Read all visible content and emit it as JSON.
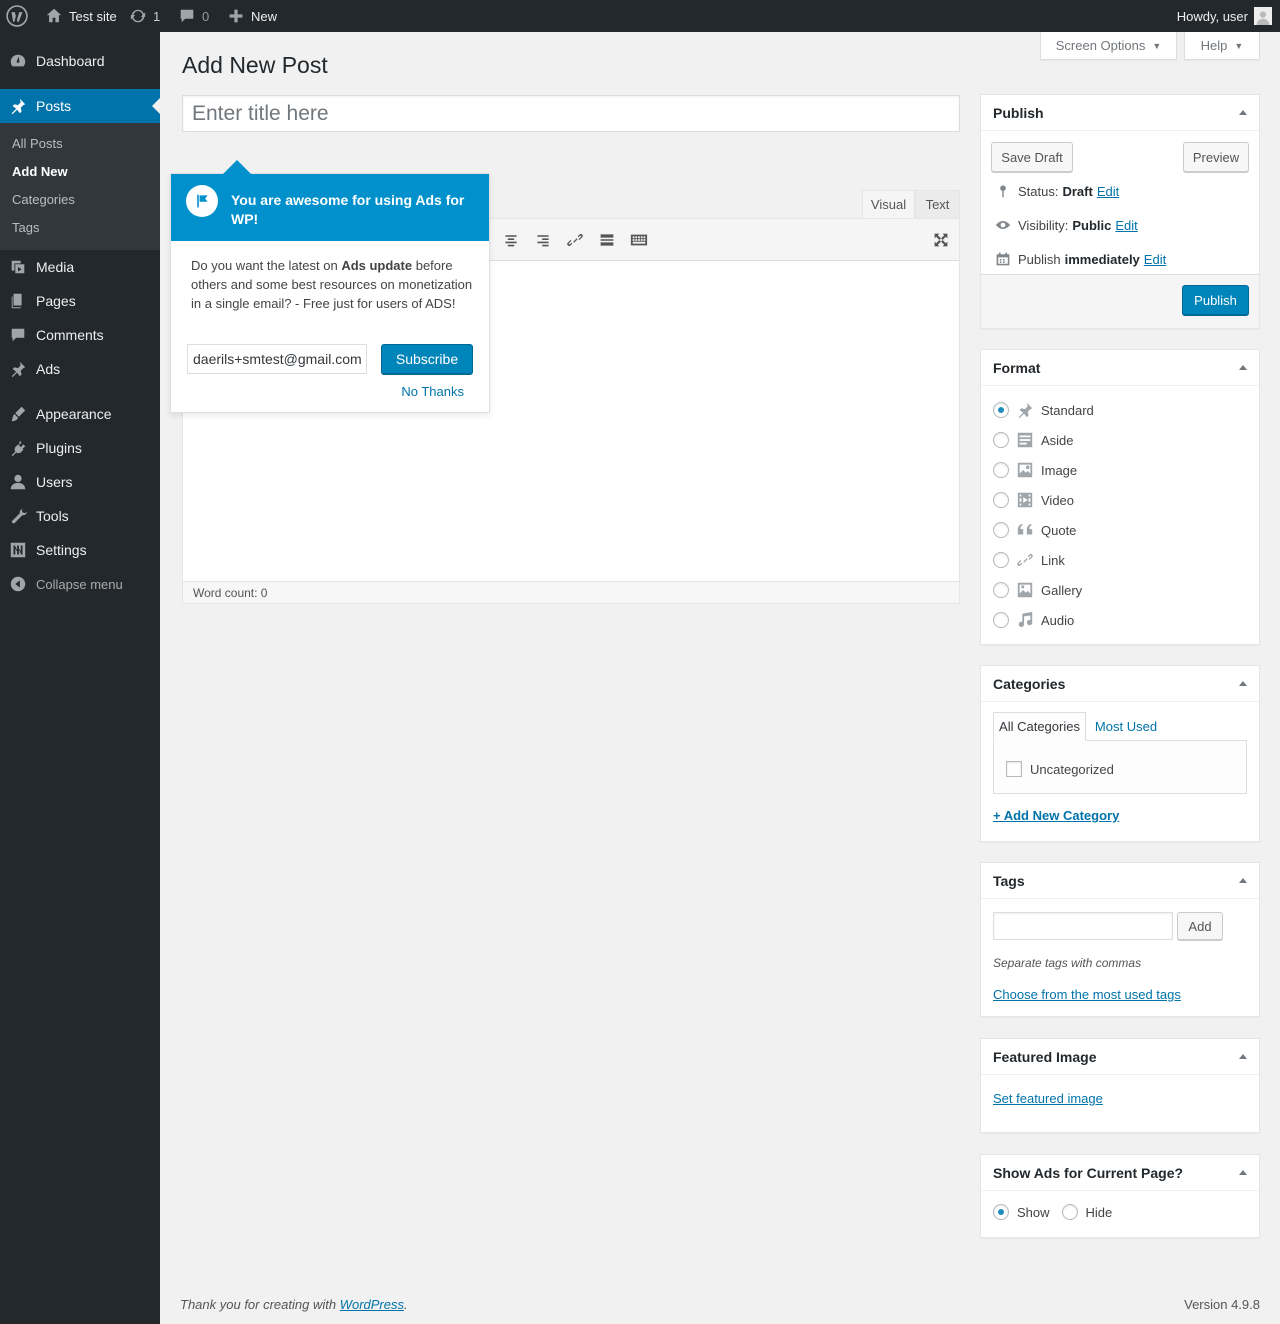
{
  "admin_bar": {
    "site_name": "Test site",
    "updates_count": "1",
    "comments_count": "0",
    "new_label": "New",
    "account_label": "Howdy, user"
  },
  "menu": {
    "items": [
      {
        "label": "Dashboard",
        "icon": "dashboard-icon"
      },
      {
        "label": "Posts",
        "icon": "pin-icon"
      },
      {
        "label": "Media",
        "icon": "media-icon"
      },
      {
        "label": "Pages",
        "icon": "pages-icon"
      },
      {
        "label": "Comments",
        "icon": "comments-icon"
      },
      {
        "label": "Ads",
        "icon": "pin-icon"
      },
      {
        "label": "Appearance",
        "icon": "appearance-icon"
      },
      {
        "label": "Plugins",
        "icon": "plugins-icon"
      },
      {
        "label": "Users",
        "icon": "users-icon"
      },
      {
        "label": "Tools",
        "icon": "tools-icon"
      },
      {
        "label": "Settings",
        "icon": "settings-icon"
      }
    ],
    "posts_submenu": [
      "All Posts",
      "Add New",
      "Categories",
      "Tags"
    ],
    "collapse_label": "Collapse menu"
  },
  "header": {
    "screen_options": "Screen Options",
    "help": "Help",
    "page_title": "Add New Post"
  },
  "title_field": {
    "placeholder": "Enter title here",
    "value": ""
  },
  "editor": {
    "tab_visual": "Visual",
    "tab_text": "Text",
    "word_count": "Word count: 0"
  },
  "pointer": {
    "heading": "You are awesome for using Ads for WP!",
    "body_1": "Do you want the latest on ",
    "body_bold": "Ads update",
    "body_2": " before others and some best resources on monetization in a single email? - Free just for users of ADS!",
    "email_value": "daerils+smtest@gmail.com",
    "subscribe": "Subscribe",
    "no_thanks": "No Thanks"
  },
  "publish": {
    "title": "Publish",
    "save_draft": "Save Draft",
    "preview": "Preview",
    "status_label": "Status:",
    "status_value": "Draft",
    "visibility_label": "Visibility:",
    "visibility_value": "Public",
    "publish_label": "Publish",
    "publish_value": "immediately",
    "edit": "Edit",
    "publish_button": "Publish"
  },
  "format": {
    "title": "Format",
    "selected": "Standard",
    "options": [
      {
        "label": "Standard",
        "icon": "pin-icon"
      },
      {
        "label": "Aside",
        "icon": "aside-icon"
      },
      {
        "label": "Image",
        "icon": "image-icon"
      },
      {
        "label": "Video",
        "icon": "video-icon"
      },
      {
        "label": "Quote",
        "icon": "quote-icon"
      },
      {
        "label": "Link",
        "icon": "link-icon"
      },
      {
        "label": "Gallery",
        "icon": "gallery-icon"
      },
      {
        "label": "Audio",
        "icon": "audio-icon"
      }
    ]
  },
  "categories": {
    "title": "Categories",
    "tab_all": "All Categories",
    "tab_most_used": "Most Used",
    "items": [
      "Uncategorized"
    ],
    "add_new": "+ Add New Category"
  },
  "tags": {
    "title": "Tags",
    "input_value": "",
    "add_button": "Add",
    "hint": "Separate tags with commas",
    "choose_link": "Choose from the most used tags"
  },
  "featured_image": {
    "title": "Featured Image",
    "set_link": "Set featured image"
  },
  "show_ads": {
    "title": "Show Ads for Current Page?",
    "show": "Show",
    "hide": "Hide",
    "selected": "Show"
  },
  "footer": {
    "thanks_prefix": "Thank you for creating with ",
    "wordpress_link": "WordPress",
    "thanks_suffix": ".",
    "version": "Version 4.9.8"
  },
  "colors": {
    "admin_bar": "#23282d",
    "accent": "#0073aa",
    "pointer_header": "#0091cd",
    "primary_button": "#0085ba"
  }
}
